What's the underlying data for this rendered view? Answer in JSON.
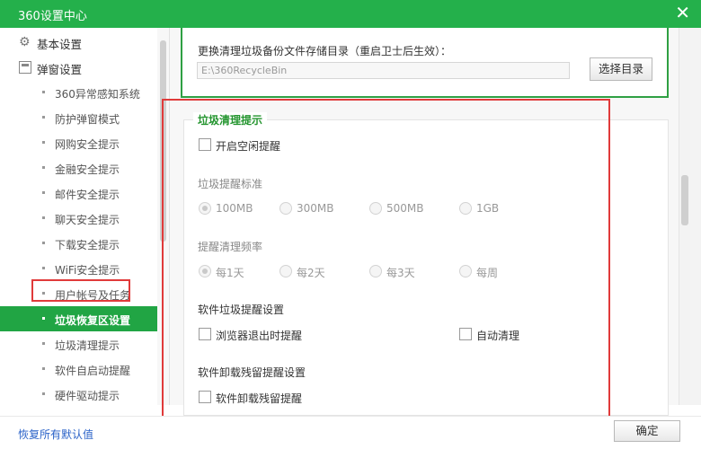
{
  "window": {
    "title": "360设置中心",
    "close_icon": "close-icon"
  },
  "sidebar": {
    "top_items": [
      {
        "label": "基本设置",
        "icon": "gear-icon"
      },
      {
        "label": "弹窗设置",
        "icon": "collapse-box-icon"
      }
    ],
    "sub_items": [
      {
        "label": "360异常感知系统"
      },
      {
        "label": "防护弹窗模式"
      },
      {
        "label": "网购安全提示"
      },
      {
        "label": "金融安全提示"
      },
      {
        "label": "邮件安全提示"
      },
      {
        "label": "聊天安全提示"
      },
      {
        "label": "下载安全提示"
      },
      {
        "label": "WiFi安全提示"
      },
      {
        "label": "用户帐号及任务"
      },
      {
        "label": "垃圾恢复区设置",
        "active": true
      },
      {
        "label": "垃圾清理提示"
      },
      {
        "label": "软件自启动提醒"
      },
      {
        "label": "硬件驱动提示"
      }
    ]
  },
  "backup": {
    "title": "更换清理垃圾备份文件存储目录（重启卫士后生效）：",
    "path_value": "E:\\360RecycleBin",
    "select_button": "选择目录"
  },
  "junk": {
    "legend": "垃圾清理提示",
    "idle_reminder": {
      "label": "开启空闲提醒",
      "checked": false
    },
    "threshold": {
      "label": "垃圾提醒标准",
      "options": [
        "100MB",
        "300MB",
        "500MB",
        "1GB"
      ],
      "selected": "100MB",
      "disabled": true
    },
    "frequency": {
      "label": "提醒清理频率",
      "options": [
        "每1天",
        "每2天",
        "每3天",
        "每周"
      ],
      "selected": "每1天",
      "disabled": true
    },
    "software_junk": {
      "heading": "软件垃圾提醒设置",
      "browser_exit": {
        "label": "浏览器退出时提醒",
        "checked": false
      },
      "auto_clean": {
        "label": "自动清理",
        "checked": false
      }
    },
    "uninstall": {
      "heading": "软件卸载残留提醒设置",
      "remnant": {
        "label": "软件卸载残留提醒",
        "checked": false
      }
    }
  },
  "footer": {
    "restore_link": "恢复所有默认值",
    "ok_button": "确定"
  },
  "colors": {
    "title_bar": "#24b04b",
    "active_item": "#21a544",
    "legend_text": "#24952f",
    "annotation_red": "#e03a3a",
    "link_blue": "#2a62c8"
  }
}
